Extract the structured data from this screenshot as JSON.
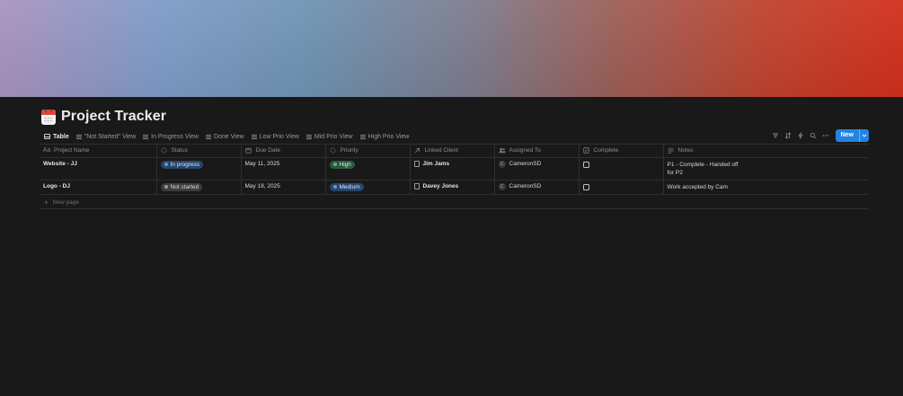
{
  "page": {
    "title": "Project Tracker",
    "icon": "calendar-icon"
  },
  "views": [
    {
      "label": "Table",
      "icon": "table-icon",
      "active": true
    },
    {
      "label": "\"Not Started\" View",
      "icon": "list-icon",
      "active": false
    },
    {
      "label": "In Progress View",
      "icon": "list-icon",
      "active": false
    },
    {
      "label": "Done View",
      "icon": "list-icon",
      "active": false
    },
    {
      "label": "Low Prio View",
      "icon": "list-icon",
      "active": false
    },
    {
      "label": "Mid Prio View",
      "icon": "list-icon",
      "active": false
    },
    {
      "label": "High Prio View",
      "icon": "list-icon",
      "active": false
    }
  ],
  "toolbar": {
    "icons": [
      "filter-icon",
      "sort-icon",
      "automation-icon",
      "search-icon",
      "more-icon"
    ],
    "new_label": "New",
    "accent": "#2383e2"
  },
  "table": {
    "columns": [
      {
        "label": "Project Name",
        "icon": "text-icon"
      },
      {
        "label": "Status",
        "icon": "status-icon"
      },
      {
        "label": "Due Date",
        "icon": "calendar-small-icon"
      },
      {
        "label": "Priority",
        "icon": "priority-icon"
      },
      {
        "label": "Linked Client",
        "icon": "relation-arrow-icon"
      },
      {
        "label": "Assigned To",
        "icon": "people-icon"
      },
      {
        "label": "Complete",
        "icon": "checkbox-icon"
      },
      {
        "label": "Notes",
        "icon": "notes-lines-icon"
      }
    ],
    "rows": [
      {
        "project_name": "Website - JJ",
        "status": "In progress",
        "due_date": "May 11, 2025",
        "priority": "High",
        "linked_client": "Jim Jams",
        "assigned_to": "CameronSD",
        "assigned_initial": "C",
        "complete": false,
        "notes_line1": "P1 - Complete - Handed off",
        "notes_line2": "for P2"
      },
      {
        "project_name": "Logo - DJ",
        "status": "Not started",
        "due_date": "May 18, 2025",
        "priority": "Medium",
        "linked_client": "Davey Jones",
        "assigned_to": "CameronSD",
        "assigned_initial": "C",
        "complete": false,
        "notes_line1": "Work accepted by Cam"
      }
    ],
    "new_page_label": "New page"
  },
  "colors": {
    "status_in_progress": "#28456c",
    "status_not_started": "#3d3d3d",
    "priority_high": "#2b593f",
    "priority_medium": "#28456c"
  }
}
